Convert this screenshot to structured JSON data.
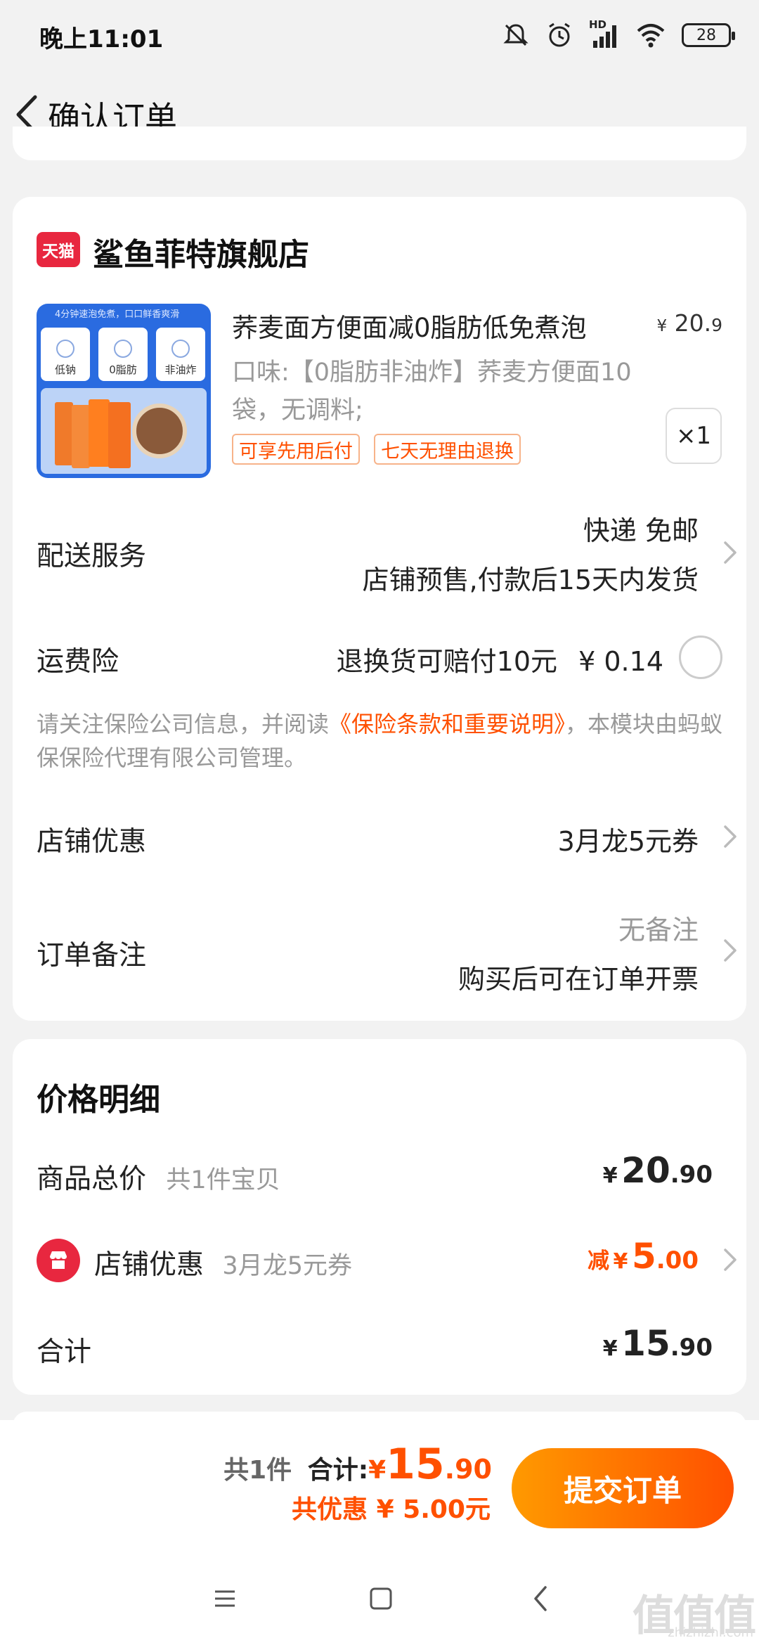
{
  "status_bar": {
    "time": "晚上11:01",
    "network_label": "HD",
    "battery": "28",
    "icons": [
      "mute-icon",
      "alarm-icon",
      "signal-icon",
      "wifi-icon",
      "battery-icon"
    ]
  },
  "header": {
    "title": "确认订单",
    "back_icon": "chevron-left-icon"
  },
  "store": {
    "logo_text": "天猫",
    "name": "鲨鱼菲特旗舰店"
  },
  "product": {
    "image_labels": [
      "4分钟速泡免煮，口口鲜香爽滑",
      "低钠",
      "0脂肪",
      "非油炸"
    ],
    "title": "荞麦面方便面减0脂肪低免煮泡",
    "price_currency": "¥",
    "price_int": "20.",
    "price_dec": "9",
    "sku": "口味:【0脂肪非油炸】荞麦方便面10袋，无调料;",
    "tags": [
      "可享先用后付",
      "七天无理由退换"
    ],
    "quantity": "×1"
  },
  "delivery": {
    "label": "配送服务",
    "method": "快递 免邮",
    "note": "店铺预售,付款后15天内发货"
  },
  "insurance": {
    "label": "运费险",
    "desc": "退换货可赔付10元",
    "price": "¥ 0.14",
    "selected": false
  },
  "insurance_notice": {
    "pre": "请关注保险公司信息，并阅读",
    "link": "《保险条款和重要说明》",
    "post": "，本模块由蚂蚁保保险代理有限公司管理。"
  },
  "store_discount": {
    "label": "店铺优惠",
    "value": "3月龙5元券"
  },
  "order_note": {
    "label": "订单备注",
    "value": "无备注",
    "sub": "购买后可在订单开票"
  },
  "price_detail": {
    "title": "价格明细",
    "goods_total_label": "商品总价",
    "goods_count": "共1件宝贝",
    "goods_total_cur": "¥",
    "goods_total_int": "20",
    "goods_total_dec": ".90",
    "discount_label": "店铺优惠",
    "discount_name": "3月龙5元券",
    "discount_prefix": "减",
    "discount_cur": "¥",
    "discount_int": "5",
    "discount_dec": ".00",
    "total_label": "合计",
    "total_cur": "¥",
    "total_int": "15",
    "total_dec": ".90"
  },
  "bottom": {
    "count": "共1件",
    "total_label": "合计:",
    "total_cur": "¥",
    "total_int": "15",
    "total_dec": ".90",
    "saved": "共优惠 ¥ 5.00元",
    "submit_label": "提交订单"
  },
  "nav": {
    "icons": [
      "menu-icon",
      "home-icon",
      "back-icon"
    ]
  },
  "watermark": {
    "text": "值值值",
    "sub": "zhizhizhi.com"
  },
  "colors": {
    "accent": "#ff5000",
    "brand_red": "#e8273f",
    "button_gradient_start": "#ff9a00",
    "button_gradient_end": "#ff5000",
    "background": "#f2f2f2"
  }
}
